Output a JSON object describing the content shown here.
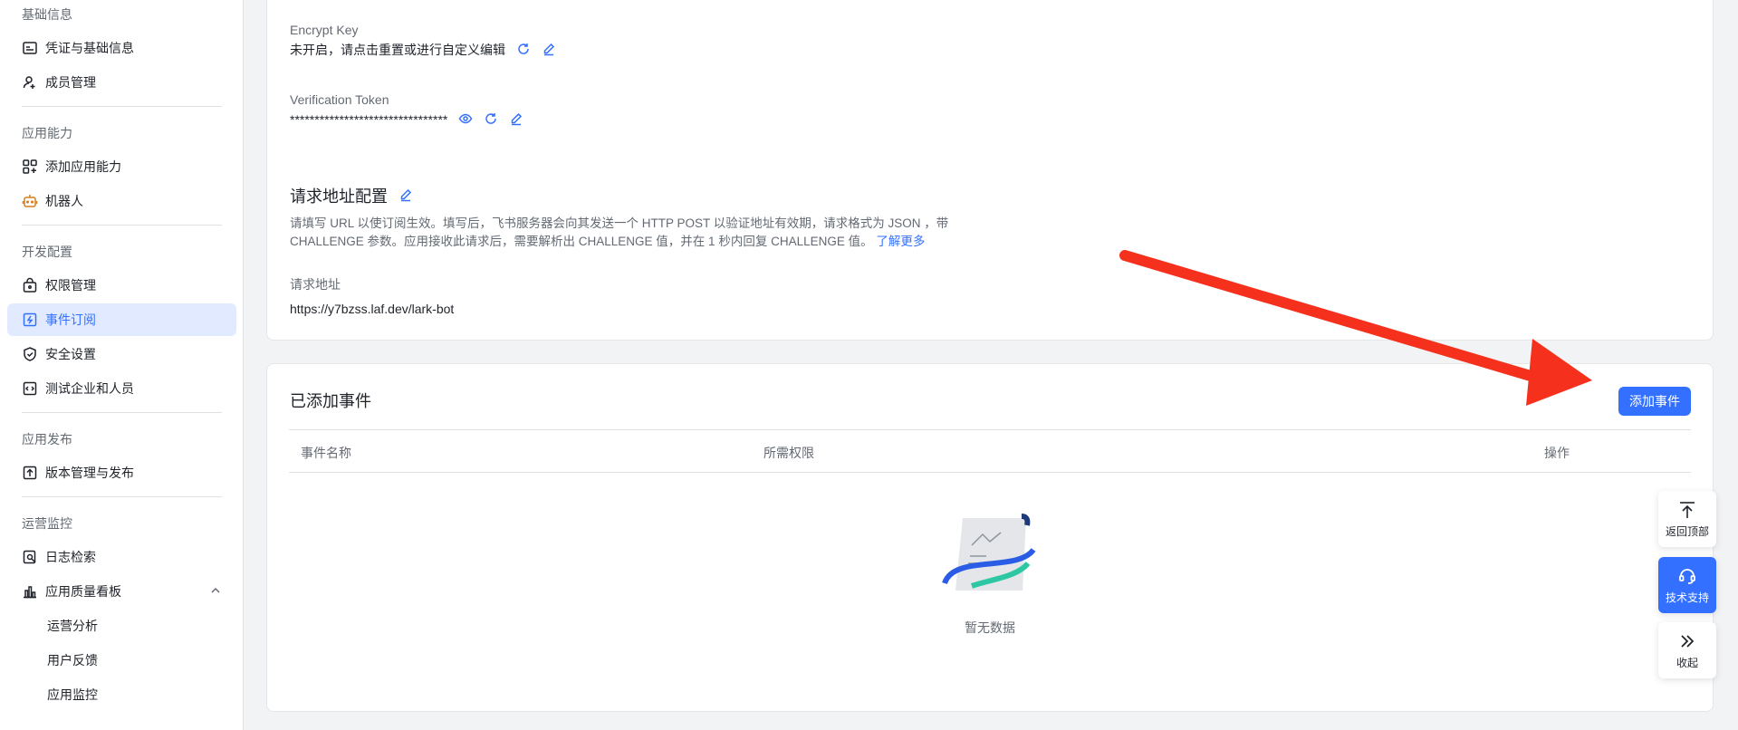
{
  "sidebar": {
    "groups": {
      "basic": "基础信息",
      "capability": "应用能力",
      "dev": "开发配置",
      "publish": "应用发布",
      "ops": "运营监控"
    },
    "items": {
      "credentials": "凭证与基础信息",
      "members": "成员管理",
      "add_capability": "添加应用能力",
      "bot": "机器人",
      "permissions": "权限管理",
      "events": "事件订阅",
      "security": "安全设置",
      "test_tenant": "测试企业和人员",
      "versions": "版本管理与发布",
      "logs": "日志检索",
      "quality": "应用质量看板",
      "ops_analysis": "运营分析",
      "feedback": "用户反馈",
      "monitoring": "应用监控"
    }
  },
  "config": {
    "encrypt_key_label": "Encrypt Key",
    "encrypt_key_value": "未开启，请点击重置或进行自定义编辑",
    "token_label": "Verification Token",
    "token_value": "********************************",
    "request_url_title": "请求地址配置",
    "description_line1": "请填写 URL 以使订阅生效。填写后，飞书服务器会向其发送一个 HTTP POST 以验证地址有效期，请求格式为 JSON ，带",
    "description_line2": "CHALLENGE 参数。应用接收此请求后，需要解析出 CHALLENGE 值，并在 1 秒内回复 CHALLENGE 值。",
    "learn_more": "了解更多",
    "request_url_label": "请求地址",
    "request_url_value": "https://y7bzss.laf.dev/lark-bot"
  },
  "events": {
    "title": "已添加事件",
    "add_button": "添加事件",
    "columns": [
      "事件名称",
      "所需权限",
      "操作"
    ],
    "empty_text": "暂无数据"
  },
  "float_tools": {
    "back_to_top": "返回顶部",
    "support": "技术支持",
    "collapse": "收起"
  },
  "colors": {
    "accent": "#3370ff",
    "annotation_arrow": "#f5311e"
  }
}
